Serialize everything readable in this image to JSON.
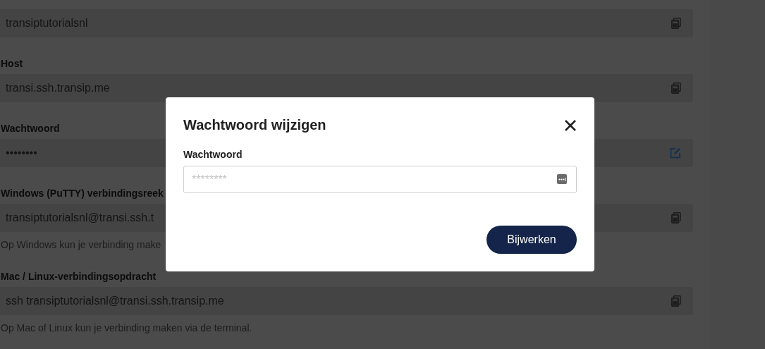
{
  "fields": [
    {
      "value": "transiptutorialsnl",
      "kind": "copy"
    },
    {
      "label": "Host",
      "value": "transi.ssh.transip.me",
      "kind": "copy"
    },
    {
      "label": "Wachtwoord",
      "value": "••••••••",
      "kind": "edit"
    },
    {
      "label": "Windows (PuTTY) verbindingsreek",
      "value": "transiptutorialsnl@transi.ssh.t",
      "hint": "Op Windows kun je verbinding make",
      "kind": "copy"
    },
    {
      "label": "Mac / Linux-verbindingsopdracht",
      "value": "ssh transiptutorialsnl@transi.ssh.transip.me",
      "hint": "Op Mac of Linux kun je verbinding maken via de terminal.",
      "kind": "copy"
    }
  ],
  "dialog": {
    "title": "Wachtwoord wijzigen",
    "field_label": "Wachtwoord",
    "placeholder": "********",
    "button": "Bijwerken"
  }
}
